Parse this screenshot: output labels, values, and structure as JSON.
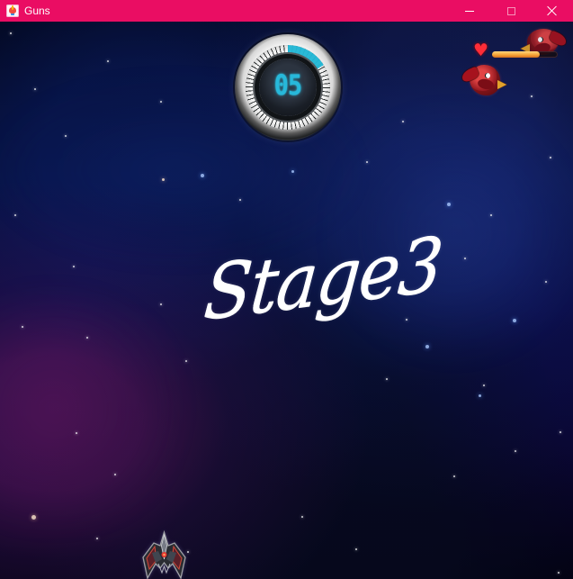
{
  "window": {
    "title": "Guns",
    "icon": "app-icon",
    "controls": {
      "minimize_icon": "minimize-icon",
      "maximize_icon": "maximize-icon",
      "close_icon": "close-icon"
    },
    "accent_color": "#ea0d63"
  },
  "game": {
    "timer": {
      "display": "05",
      "progress_fraction": 0.16
    },
    "stage": {
      "label": "Stage3"
    },
    "player": {
      "health_fraction": 0.72,
      "heart_icon": "heart-icon",
      "bird_icon": "red-bird-icon",
      "spaceship_icon": "spaceship-icon"
    },
    "colors": {
      "timer": "#27b8da",
      "health": "#f4a033",
      "stage_text": "#ffffff"
    }
  }
}
